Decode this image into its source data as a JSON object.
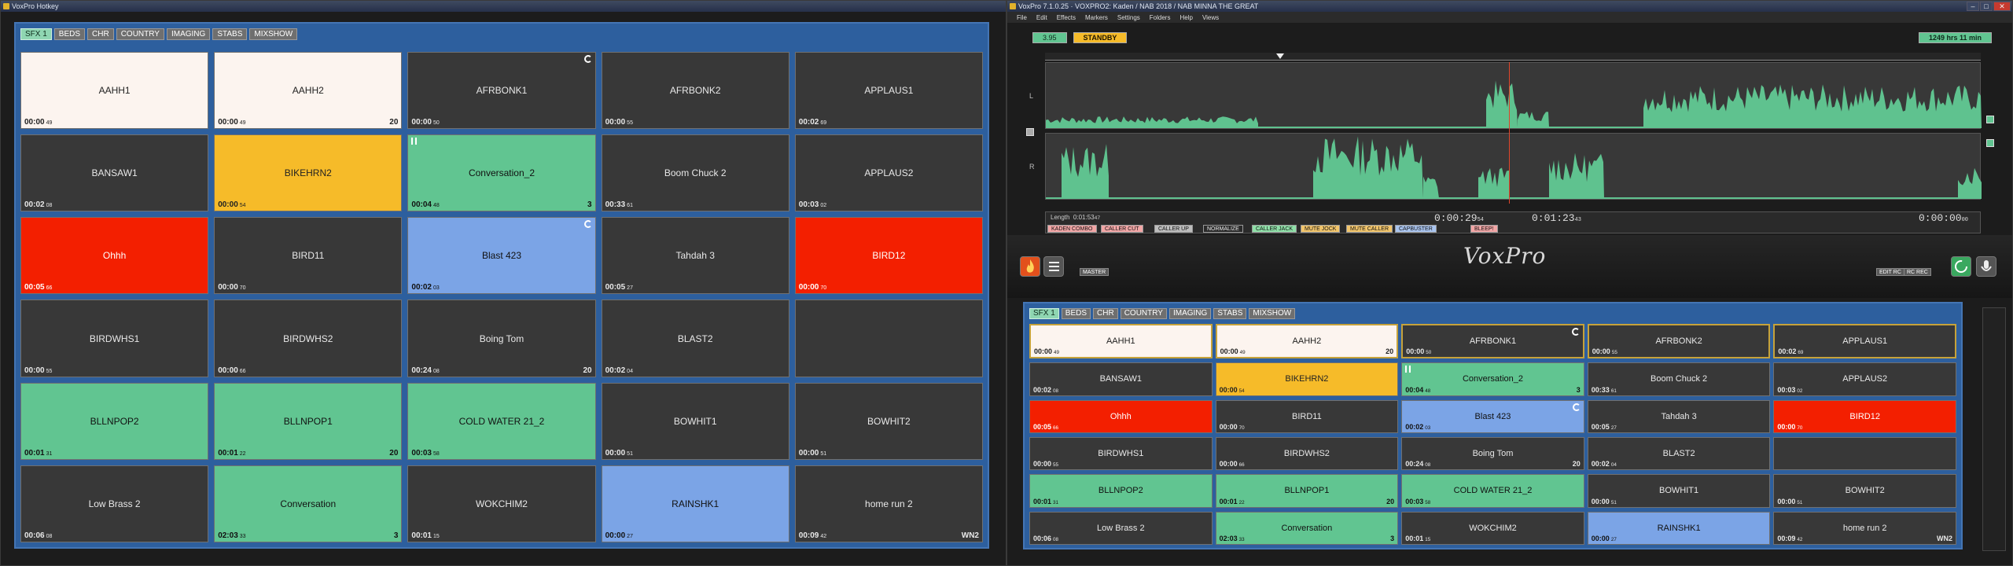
{
  "hotkey": {
    "title": "VoxPro Hotkey",
    "tabs": [
      "SFX 1",
      "BEDS",
      "CHR",
      "COUNTRY",
      "IMAGING",
      "STABS",
      "MIXSHOW"
    ],
    "buttons": [
      {
        "name": "AAHH1",
        "time": "00:00",
        "ms": "49",
        "color": "cream",
        "count": "",
        "loop": false,
        "pause": false
      },
      {
        "name": "AAHH2",
        "time": "00:00",
        "ms": "49",
        "color": "cream",
        "count": "20",
        "loop": false,
        "pause": false
      },
      {
        "name": "AFRBONK1",
        "time": "00:00",
        "ms": "50",
        "color": "dark",
        "count": "",
        "loop": true,
        "pause": false
      },
      {
        "name": "AFRBONK2",
        "time": "00:00",
        "ms": "55",
        "color": "dark",
        "count": "",
        "loop": false,
        "pause": false
      },
      {
        "name": "APPLAUS1",
        "time": "00:02",
        "ms": "69",
        "color": "dark",
        "count": "",
        "loop": false,
        "pause": false
      },
      {
        "name": "BANSAW1",
        "time": "00:02",
        "ms": "08",
        "color": "dark",
        "count": "",
        "loop": false,
        "pause": false
      },
      {
        "name": "BIKEHRN2",
        "time": "00:00",
        "ms": "54",
        "color": "yellow",
        "count": "",
        "loop": false,
        "pause": false
      },
      {
        "name": "Conversation_2",
        "time": "00:04",
        "ms": "48",
        "color": "green",
        "count": "3",
        "loop": false,
        "pause": true
      },
      {
        "name": "Boom Chuck 2",
        "time": "00:33",
        "ms": "61",
        "color": "dark",
        "count": "",
        "loop": false,
        "pause": false
      },
      {
        "name": "APPLAUS2",
        "time": "00:03",
        "ms": "02",
        "color": "dark",
        "count": "",
        "loop": false,
        "pause": false
      },
      {
        "name": "Ohhh",
        "time": "00:05",
        "ms": "66",
        "color": "red",
        "count": "",
        "loop": false,
        "pause": false
      },
      {
        "name": "BIRD11",
        "time": "00:00",
        "ms": "70",
        "color": "dark",
        "count": "",
        "loop": false,
        "pause": false
      },
      {
        "name": "Blast 423",
        "time": "00:02",
        "ms": "03",
        "color": "blue",
        "count": "",
        "loop": true,
        "pause": false
      },
      {
        "name": "Tahdah 3",
        "time": "00:05",
        "ms": "27",
        "color": "dark",
        "count": "",
        "loop": false,
        "pause": false
      },
      {
        "name": "BIRD12",
        "time": "00:00",
        "ms": "70",
        "color": "red",
        "count": "",
        "loop": false,
        "pause": false
      },
      {
        "name": "BIRDWHS1",
        "time": "00:00",
        "ms": "55",
        "color": "dark",
        "count": "",
        "loop": false,
        "pause": false
      },
      {
        "name": "BIRDWHS2",
        "time": "00:00",
        "ms": "66",
        "color": "dark",
        "count": "",
        "loop": false,
        "pause": false
      },
      {
        "name": "Boing Tom",
        "time": "00:24",
        "ms": "08",
        "color": "dark",
        "count": "20",
        "loop": false,
        "pause": false
      },
      {
        "name": "BLAST2",
        "time": "00:02",
        "ms": "04",
        "color": "dark",
        "count": "",
        "loop": false,
        "pause": false
      },
      {
        "name": "",
        "time": "",
        "ms": "",
        "color": "dark",
        "count": "",
        "loop": false,
        "pause": false
      },
      {
        "name": "BLLNPOP2",
        "time": "00:01",
        "ms": "31",
        "color": "green",
        "count": "",
        "loop": false,
        "pause": false
      },
      {
        "name": "BLLNPOP1",
        "time": "00:01",
        "ms": "22",
        "color": "green",
        "count": "20",
        "loop": false,
        "pause": false
      },
      {
        "name": "COLD WATER 21_2",
        "time": "00:03",
        "ms": "58",
        "color": "green",
        "count": "",
        "loop": false,
        "pause": false
      },
      {
        "name": "BOWHIT1",
        "time": "00:00",
        "ms": "51",
        "color": "dark",
        "count": "",
        "loop": false,
        "pause": false
      },
      {
        "name": "BOWHIT2",
        "time": "00:00",
        "ms": "51",
        "color": "dark",
        "count": "",
        "loop": false,
        "pause": false
      },
      {
        "name": "Low Brass 2",
        "time": "00:06",
        "ms": "08",
        "color": "dark",
        "count": "",
        "loop": false,
        "pause": false
      },
      {
        "name": "Conversation",
        "time": "02:03",
        "ms": "33",
        "color": "green",
        "count": "3",
        "loop": false,
        "pause": false
      },
      {
        "name": "WOKCHIM2",
        "time": "00:01",
        "ms": "15",
        "color": "dark",
        "count": "",
        "loop": false,
        "pause": false
      },
      {
        "name": "RAINSHK1",
        "time": "00:00",
        "ms": "27",
        "color": "blue",
        "count": "",
        "loop": false,
        "pause": false
      },
      {
        "name": "home run 2",
        "time": "00:09",
        "ms": "42",
        "color": "dark",
        "count": "WN2",
        "loop": false,
        "pause": false
      }
    ]
  },
  "voxpro": {
    "title": "VoxPro 7.1.0.25 · VOXPRO2: Kaden / NAB 2018 / NAB MINNA THE GREAT",
    "menu": [
      "File",
      "Edit",
      "Effects",
      "Markers",
      "Settings",
      "Folders",
      "Help",
      "Views"
    ],
    "time_display": "3.95",
    "state": "STANDBY",
    "hours_free": "1249 hrs 11 min",
    "channel_left": "L",
    "channel_right": "R",
    "length_label": "Length",
    "length_value": "0:01:53",
    "length_ms": "47",
    "marker_a": "0:00:29",
    "marker_a_ms": "54",
    "marker_b": "0:01:23",
    "marker_b_ms": "43",
    "marker_c": "0:00:00",
    "marker_c_ms": "00",
    "caller_buttons": [
      {
        "label": "KADEN COMBO",
        "color": "#f2a6a6"
      },
      {
        "label": "CALLER CUT",
        "color": "#f2a6a6"
      },
      {
        "label": "CALLER UP",
        "color": "#bdbdbd"
      },
      {
        "label": "NORMALIZE",
        "color": "#2a2a2a"
      },
      {
        "label": "CALLER JACK",
        "color": "#8fe0a8"
      },
      {
        "label": "MUTE JOCK",
        "color": "#f2c56b"
      },
      {
        "label": "MUTE CALLER",
        "color": "#f2c56b"
      },
      {
        "label": "CAPBUSTER",
        "color": "#a9c4ef"
      },
      {
        "label": "BLEEP!",
        "color": "#f2a6a6"
      }
    ],
    "logo": "VoxPro",
    "master_label": "MASTER",
    "edit_rec_label": "EDIT RC",
    "rc_rec_label": "RC REC"
  },
  "colors": {
    "cream": "#fcf4ef",
    "yellow": "#f6bb29",
    "green": "#61c591",
    "red": "#f31f00",
    "blue": "#7ba4e6",
    "dark": "#383838",
    "panel": "#2d5f9e"
  },
  "icons": [
    "fire-icon",
    "list-icon",
    "refresh-icon",
    "microphone-icon",
    "loop-icon",
    "pause-icon"
  ]
}
